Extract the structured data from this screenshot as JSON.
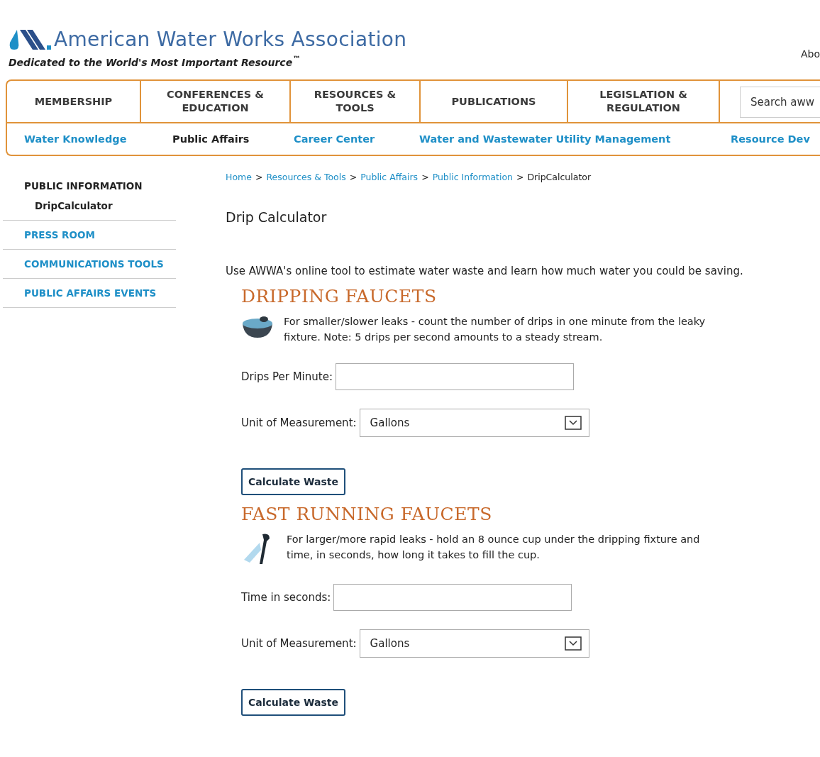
{
  "header": {
    "logo_text": "American Water Works Association",
    "tagline": "Dedicated to the World's Most Important Resource$^{™}$",
    "top_link": "Abo"
  },
  "main_nav": [
    {
      "label": "MEMBERSHIP"
    },
    {
      "label": "CONFERENCES & EDUCATION"
    },
    {
      "label": "RESOURCES & TOOLS"
    },
    {
      "label": "PUBLICATIONS"
    },
    {
      "label": "LEGISLATION & REGULATION"
    }
  ],
  "search": {
    "placeholder": "Search aww"
  },
  "sub_nav": [
    {
      "label": "Water Knowledge",
      "selected": false
    },
    {
      "label": "Public Affairs",
      "selected": true
    },
    {
      "label": "Career Center",
      "selected": false
    },
    {
      "label": "Water and Wastewater Utility Management",
      "selected": false
    },
    {
      "label": "Resource Dev",
      "selected": false
    }
  ],
  "sidebar": [
    {
      "label": "PUBLIC INFORMATION",
      "selected": true,
      "children": [
        {
          "label": "DripCalculator",
          "selected": true
        }
      ]
    },
    {
      "label": "PRESS ROOM",
      "selected": false
    },
    {
      "label": "COMMUNICATIONS TOOLS",
      "selected": false
    },
    {
      "label": "PUBLIC AFFAIRS EVENTS",
      "selected": false
    }
  ],
  "breadcrumb": {
    "separator": ">",
    "items": [
      {
        "label": "Home",
        "current": false
      },
      {
        "label": "Resources & Tools",
        "current": false
      },
      {
        "label": "Public Affairs",
        "current": false
      },
      {
        "label": "Public Information",
        "current": false
      },
      {
        "label": "DripCalculator",
        "current": true
      }
    ]
  },
  "page_title": "Drip Calculator",
  "intro": "Use AWWA's online tool to estimate water waste and learn how much water you could be saving.",
  "sections": [
    {
      "heading": "DRIPPING FAUCETS",
      "kind": "bowl",
      "description": "For smaller/slower leaks - count the number of drips in one minute from the leaky fixture. Note: 5 drips per second amounts to a steady stream.",
      "fields": [
        {
          "kind": "text",
          "label": "Drips Per Minute:"
        },
        {
          "kind": "select",
          "label": "Unit of Measurement:",
          "value": "Gallons"
        }
      ],
      "button": "Calculate Waste"
    },
    {
      "heading": "FAST RUNNING FAUCETS",
      "kind": "faucet",
      "description": "For larger/more rapid leaks - hold an 8 ounce cup under the dripping fixture and time, in seconds, how long it takes to fill the cup.",
      "fields": [
        {
          "kind": "text",
          "label": "Time in seconds:"
        },
        {
          "kind": "select",
          "label": "Unit of Measurement:",
          "value": "Gallons"
        }
      ],
      "button": "Calculate Waste"
    }
  ]
}
